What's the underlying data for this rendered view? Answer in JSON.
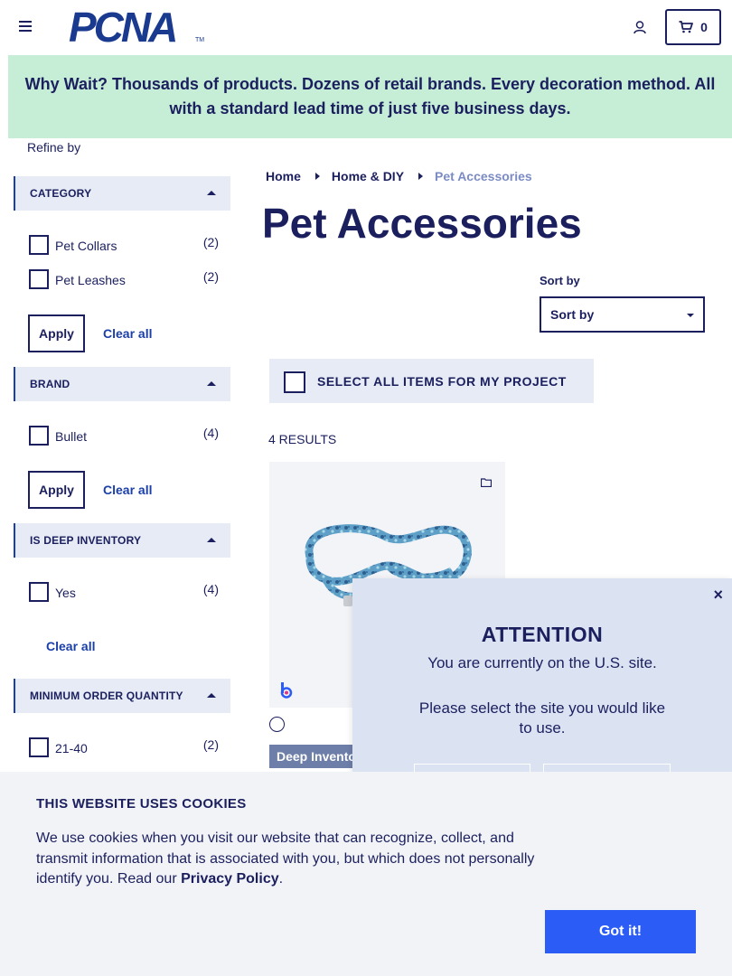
{
  "header": {
    "logo_text": "PCNA",
    "logo_tm": "TM",
    "cart_count": "0"
  },
  "banner": {
    "text": "Why Wait? Thousands of products. Dozens of retail brands. Every decoration method. All with a standard lead time of just five business days."
  },
  "sidebar": {
    "refine_label": "Refine by",
    "facets": [
      {
        "title": "CATEGORY",
        "options": [
          {
            "label": "Pet Collars",
            "count": "(2)"
          },
          {
            "label": "Pet Leashes",
            "count": "(2)"
          }
        ],
        "apply_label": "Apply",
        "clear_label": "Clear all"
      },
      {
        "title": "BRAND",
        "options": [
          {
            "label": "Bullet",
            "count": "(4)"
          }
        ],
        "apply_label": "Apply",
        "clear_label": "Clear all"
      },
      {
        "title": "IS DEEP INVENTORY",
        "options": [
          {
            "label": "Yes",
            "count": "(4)"
          }
        ],
        "clear_label": "Clear all"
      },
      {
        "title": "MINIMUM ORDER QUANTITY",
        "options": [
          {
            "label": "21-40",
            "count": "(2)"
          }
        ]
      }
    ]
  },
  "breadcrumb": [
    "Home",
    "Home & DIY",
    "Pet Accessories"
  ],
  "page_title": "Pet Accessories",
  "sort": {
    "label": "Sort by",
    "selected": "Sort by"
  },
  "select_all_label": "SELECT ALL ITEMS FOR MY PROJECT",
  "results_label": "4 RESULTS",
  "product": {
    "badge": "Deep Inventory"
  },
  "modal": {
    "title": "ATTENTION",
    "line1": "You are currently on the U.S. site.",
    "line2": "Please select the site you would like to use.",
    "close": "×"
  },
  "cookie": {
    "title": "THIS WEBSITE USES COOKIES",
    "text_before": "We use cookies when you visit our website that can recognize, collect, and transmit information that is associated with you, but which does not personally identify you. Read our ",
    "link": "Privacy Policy",
    "text_after": ".",
    "button": "Got it!"
  },
  "colors": {
    "navy": "#1b1f5e",
    "banner_green": "#c6eed7",
    "accent_blue": "#2b5cf6",
    "facet_bg": "#e6ebf5",
    "modal_bg": "#dbe3f3"
  }
}
